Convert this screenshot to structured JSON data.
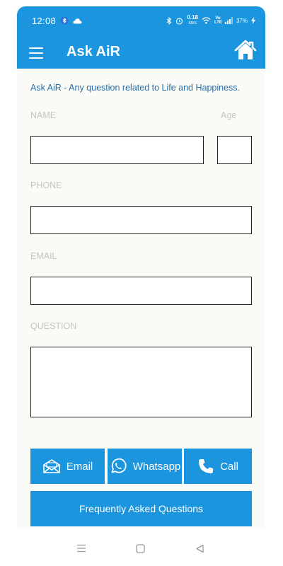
{
  "status_bar": {
    "time": "12:08",
    "net_speed_value": "0.18",
    "net_speed_unit": "KB/S",
    "volte": "Vo LTE",
    "battery": "37%"
  },
  "app_bar": {
    "title": "Ask AiR",
    "menu_icon": "hamburger-menu-icon",
    "home_icon": "home-icon"
  },
  "form": {
    "subtitle": "Ask AiR - Any question related to Life and Happiness.",
    "name_label": "NAME",
    "age_label": "Age",
    "phone_label": "PHONE",
    "email_label": "EMAIL",
    "question_label": "QUESTION",
    "name_value": "",
    "age_value": "",
    "phone_value": "",
    "email_value": "",
    "question_value": ""
  },
  "actions": {
    "email_label": "Email",
    "whatsapp_label": "Whatsapp",
    "call_label": "Call",
    "faq_label": "Frequently Asked Questions"
  },
  "colors": {
    "primary": "#1a95de",
    "subtitle_text": "#2a6fa8",
    "label_text": "#c4c4c4"
  }
}
